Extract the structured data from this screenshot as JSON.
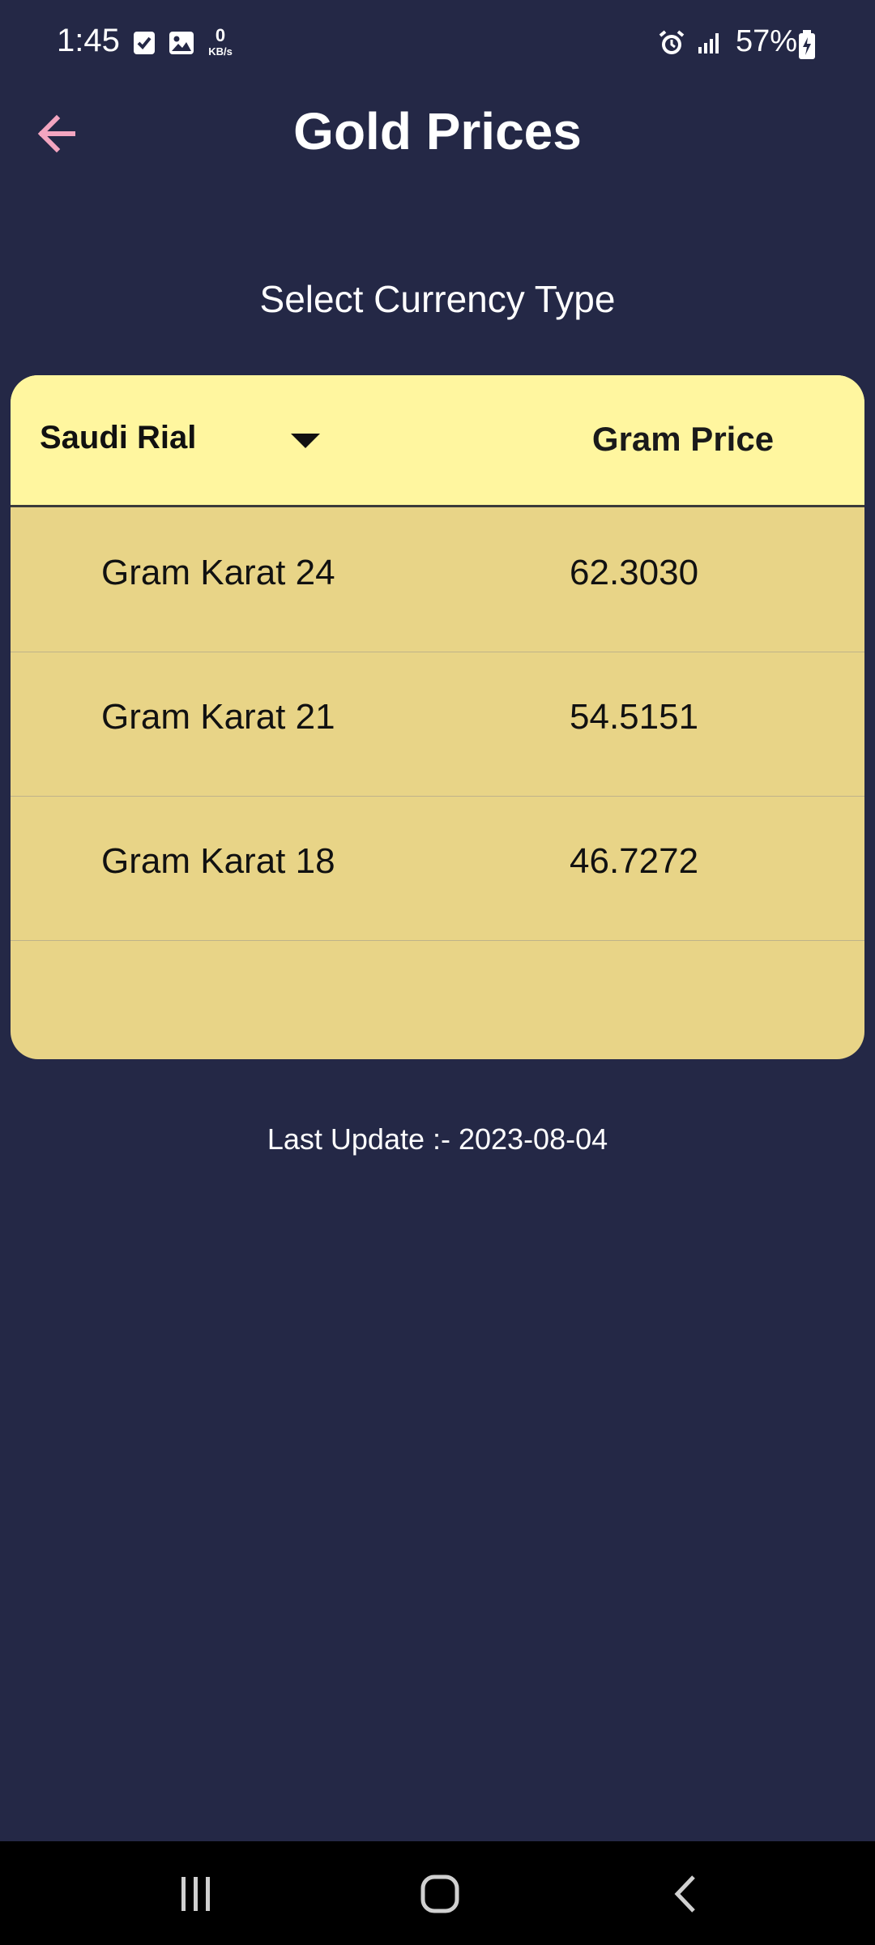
{
  "status_bar": {
    "time": "1:45",
    "network_speed_value": "0",
    "network_speed_unit": "KB/s",
    "battery_percent": "57%"
  },
  "app_bar": {
    "title": "Gold Prices"
  },
  "currency_section": {
    "label": "Select Currency Type"
  },
  "table": {
    "selected_currency": "Saudi Rial",
    "price_column_header": "Gram Price",
    "rows": [
      {
        "label": "Gram Karat 24",
        "price": "62.3030"
      },
      {
        "label": "Gram Karat 21",
        "price": "54.5151"
      },
      {
        "label": "Gram Karat 18",
        "price": "46.7272"
      }
    ]
  },
  "footer": {
    "last_update": "Last Update  :- 2023-08-04"
  },
  "colors": {
    "background": "#242846",
    "card_body": "#e8d487",
    "card_header": "#fff69f",
    "back_arrow": "#f3a5c0"
  }
}
